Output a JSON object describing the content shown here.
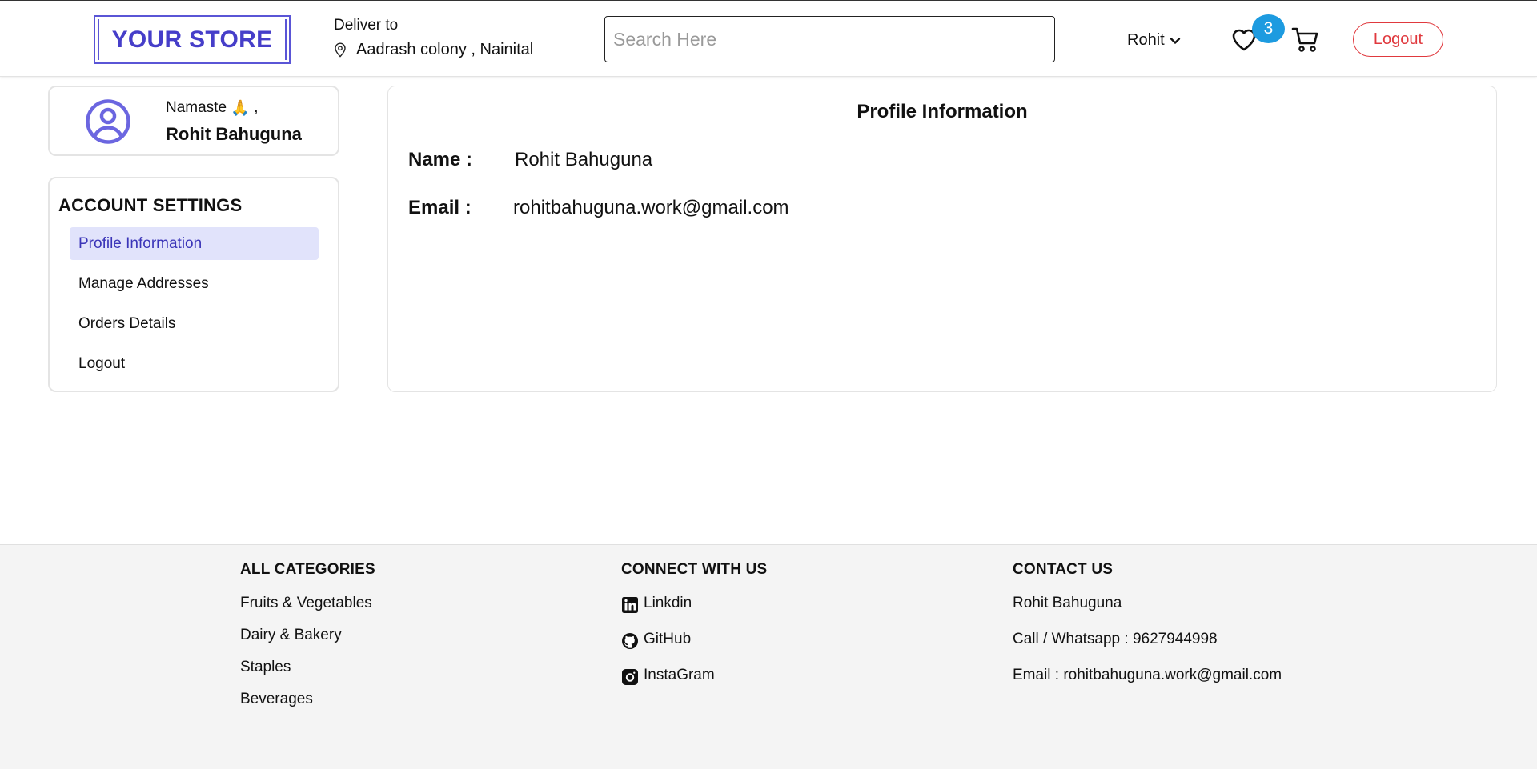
{
  "header": {
    "logo": "YOUR STORE",
    "deliver_label": "Deliver to",
    "deliver_address": "Aadrash colony , Nainital",
    "search_placeholder": "Search Here",
    "user_name": "Rohit",
    "wishlist_count": "3",
    "logout_label": "Logout"
  },
  "greeting": {
    "hello": "Namaste",
    "emoji": "🙏",
    "comma": ",",
    "name": "Rohit Bahuguna"
  },
  "settings": {
    "title": "ACCOUNT SETTINGS",
    "items": [
      {
        "label": "Profile Information",
        "active": true
      },
      {
        "label": "Manage Addresses"
      },
      {
        "label": "Orders Details"
      },
      {
        "label": "Logout"
      }
    ]
  },
  "profile": {
    "title": "Profile Information",
    "name_label": "Name :",
    "name_value": "Rohit Bahuguna",
    "email_label": "Email :",
    "email_value": "rohitbahuguna.work@gmail.com"
  },
  "footer": {
    "categories": {
      "title": "ALL CATEGORIES",
      "items": [
        "Fruits & Vegetables",
        "Dairy & Bakery",
        "Staples",
        "Beverages"
      ]
    },
    "connect": {
      "title": "CONNECT WITH US",
      "items": [
        {
          "label": "Linkdin",
          "icon": "linkedin-icon"
        },
        {
          "label": "GitHub",
          "icon": "github-icon"
        },
        {
          "label": "InstaGram",
          "icon": "instagram-icon"
        }
      ]
    },
    "contact": {
      "title": "CONTACT US",
      "items": [
        "Rohit Bahuguna",
        "Call / Whatsapp : 9627944998",
        "Email : rohitbahuguna.work@gmail.com"
      ]
    }
  },
  "colors": {
    "brand": "#463ec9",
    "active_bg": "#e1e3fb",
    "badge": "#1d9be0",
    "logout": "#e0393e",
    "footer_bg": "#f4f4f4"
  }
}
